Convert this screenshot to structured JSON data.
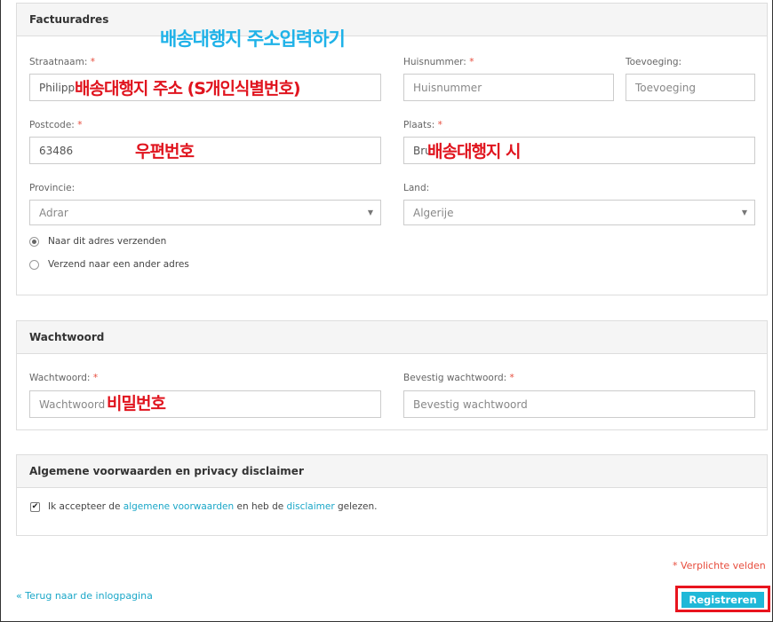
{
  "billing": {
    "title": "Factuuradres",
    "street_label": "Straatnaam:",
    "street_value": "Philipp",
    "housenumber_label": "Huisnummer:",
    "housenumber_placeholder": "Huisnummer",
    "addition_label": "Toevoeging:",
    "addition_placeholder": "Toevoeging",
    "postcode_label": "Postcode:",
    "postcode_value": "63486",
    "city_label": "Plaats:",
    "city_value": "Bru",
    "province_label": "Provincie:",
    "province_value": "Adrar",
    "country_label": "Land:",
    "country_value": "Algerije",
    "radio_same": "Naar dit adres verzenden",
    "radio_other": "Verzend naar een ander adres",
    "required_mark": "*"
  },
  "password": {
    "title": "Wachtwoord",
    "pw_label": "Wachtwoord:",
    "pw_placeholder": "Wachtwoord",
    "confirm_label": "Bevestig wachtwoord:",
    "confirm_placeholder": "Bevestig wachtwoord"
  },
  "terms": {
    "title": "Algemene voorwaarden en privacy disclaimer",
    "text_pre": "Ik accepteer de ",
    "link_terms": "algemene voorwaarden",
    "text_mid": " en heb de ",
    "link_disclaimer": "disclaimer",
    "text_post": " gelezen."
  },
  "footer": {
    "required_note": "* Verplichte velden",
    "back_link": "« Terug naar de inlogpagina",
    "submit_label": "Registreren"
  },
  "annotations": {
    "address_heading": "배송대행지 주소입력하기",
    "street_note": "배송대행지 주소 (S개인식별번호)",
    "postcode_note": "우편번호",
    "city_note": "배송대행지 시",
    "password_note": "비밀번호"
  },
  "icons": {
    "select_caret": "▼",
    "checkmark": "✔"
  },
  "colors": {
    "accent": "#1fb8d8",
    "required": "#e74c3c",
    "annotation_red": "#e0141e",
    "annotation_blue": "#1fb2e8"
  }
}
